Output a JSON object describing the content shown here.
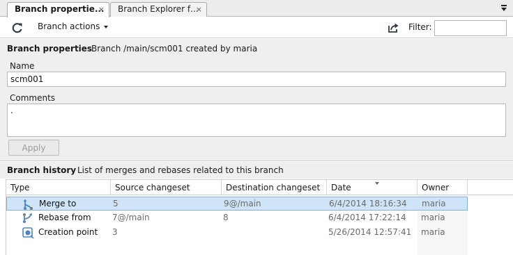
{
  "tabs": [
    {
      "label": "Branch propertie",
      "ellipsis": "...",
      "close": "×",
      "active": true
    },
    {
      "label": "Branch Explorer f",
      "ellipsis": "...",
      "close": "×",
      "active": false
    }
  ],
  "toolbar": {
    "branch_actions_label": "Branch actions",
    "filter_label": "Filter:",
    "filter_value": ""
  },
  "properties": {
    "title": "Branch properties",
    "description": "Branch /main/scm001 created by maria",
    "name_label": "Name",
    "name_value": "scm001",
    "comments_label": "Comments",
    "comments_value": ".",
    "apply_label": "Apply"
  },
  "history": {
    "title": "Branch history",
    "description": "List of merges and rebases related to this branch",
    "columns": [
      "Type",
      "Source changeset",
      "Destination changeset",
      "Date",
      "Owner"
    ],
    "sorted_column": "Date",
    "rows": [
      {
        "icon": "merge-to-icon",
        "type": "Merge to",
        "source": "5",
        "destination": "9@/main",
        "date": "6/4/2014 18:16:34",
        "owner": "maria",
        "selected": true
      },
      {
        "icon": "rebase-from-icon",
        "type": "Rebase from",
        "source": "7@/main",
        "destination": "8",
        "date": "6/4/2014 17:22:14",
        "owner": "maria",
        "selected": false
      },
      {
        "icon": "creation-point-icon",
        "type": "Creation point",
        "source": "3",
        "destination": "",
        "date": "5/26/2014 12:57:41",
        "owner": "maria",
        "selected": false
      }
    ]
  },
  "colors": {
    "selection_bg": "#cfe4f8",
    "selection_border": "#7fb1e2",
    "icon_blue": "#4a86c8",
    "panel_bg": "#efefef"
  }
}
